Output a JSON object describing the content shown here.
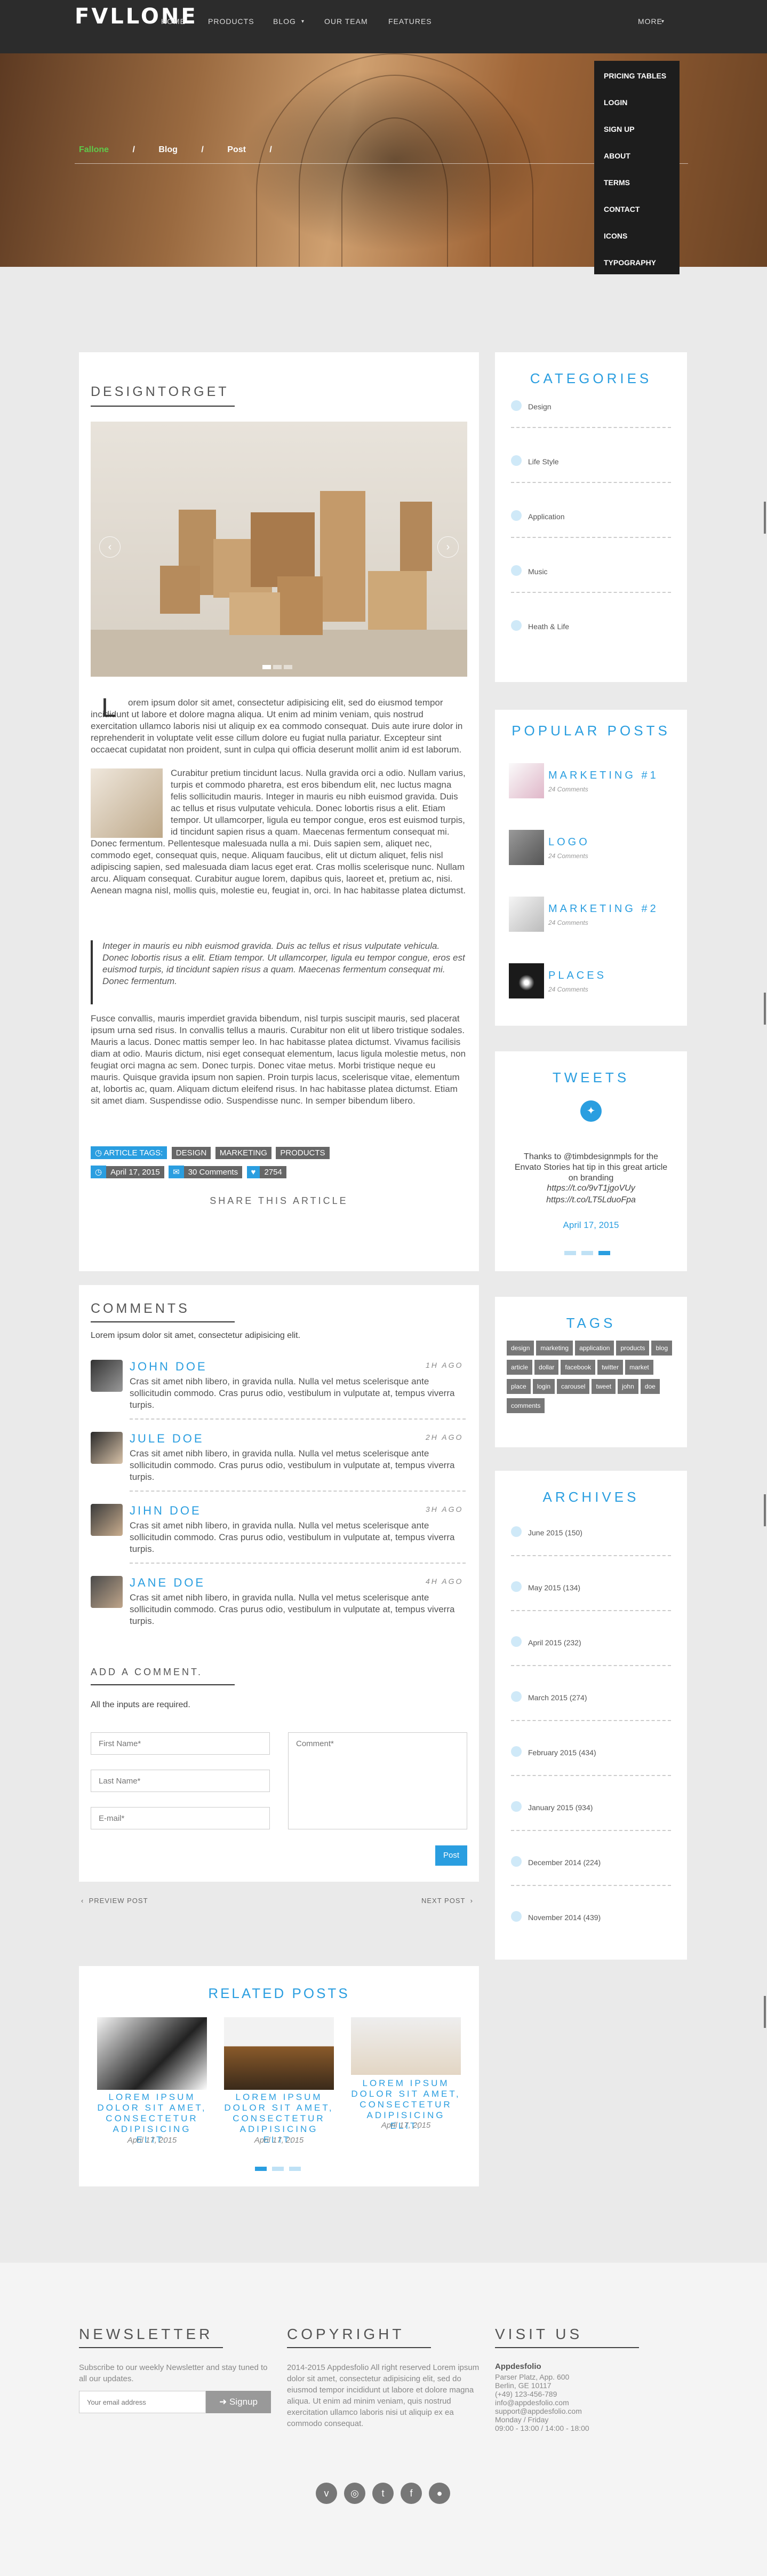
{
  "logo": "FVLLONE",
  "nav": {
    "items": [
      "HOME",
      "PRODUCTS",
      "BLOG",
      "OUR TEAM",
      "FEATURES"
    ],
    "more": "MORE"
  },
  "dropdown": [
    "PRICING TABLES",
    "LOGIN",
    "SIGN UP",
    "ABOUT",
    "TERMS",
    "CONTACT",
    "ICONS",
    "TYPOGRAPHY"
  ],
  "breadcrumb": {
    "home": "Fallone",
    "blog": "Blog",
    "post": "Post",
    "sep": "/"
  },
  "post": {
    "title": "DESIGNTORGET",
    "dropcap": "L",
    "p1": "orem ipsum dolor sit amet, consectetur adipisicing elit, sed do eiusmod tempor incididunt ut labore et dolore magna aliqua. Ut enim ad minim veniam, quis nostrud exercitation ullamco laboris nisi ut aliquip ex ea commodo consequat. Duis aute irure dolor in reprehenderit in voluptate velit esse cillum dolore eu fugiat nulla pariatur. Excepteur sint occaecat cupidatat non proident, sunt in culpa qui officia deserunt mollit anim id est laborum.",
    "p2": "Curabitur pretium tincidunt lacus. Nulla gravida orci a odio. Nullam varius, turpis et commodo pharetra, est eros bibendum elit, nec luctus magna felis sollicitudin mauris. Integer in mauris eu nibh euismod gravida. Duis ac tellus et risus vulputate vehicula. Donec lobortis risus a elit. Etiam tempor. Ut ullamcorper, ligula eu tempor congue, eros est euismod turpis, id tincidunt sapien risus a quam. Maecenas fermentum consequat mi. Donec fermentum. Pellentesque malesuada nulla a mi. Duis sapien sem, aliquet nec, commodo eget, consequat quis, neque. Aliquam faucibus, elit ut dictum aliquet, felis nisl adipiscing sapien, sed malesuada diam lacus eget erat. Cras mollis scelerisque nunc. Nullam arcu. Aliquam consequat. Curabitur augue lorem, dapibus quis, laoreet et, pretium ac, nisi. Aenean magna nisl, mollis quis, molestie eu, feugiat in, orci. In hac habitasse platea dictumst.",
    "quote": "Integer in mauris eu nibh euismod gravida. Duis ac tellus et risus vulputate vehicula. Donec lobortis risus a elit. Etiam tempor. Ut ullamcorper, ligula eu tempor congue, eros est euismod turpis, id tincidunt sapien risus a quam. Maecenas fermentum consequat mi. Donec fermentum.",
    "p3": "Fusce convallis, mauris imperdiet gravida bibendum, nisl turpis suscipit mauris, sed placerat ipsum urna sed risus. In convallis tellus a mauris. Curabitur non elit ut libero tristique sodales. Mauris a lacus. Donec mattis semper leo. In hac habitasse platea dictumst. Vivamus facilisis diam at odio. Mauris dictum, nisi eget consequat elementum, lacus ligula molestie metus, non feugiat orci magna ac sem. Donec turpis. Donec vitae metus. Morbi tristique neque eu mauris. Quisque gravida ipsum non sapien. Proin turpis lacus, scelerisque vitae, elementum at, lobortis ac, quam. Aliquam dictum eleifend risus. In hac habitasse platea dictumst. Etiam sit amet diam. Suspendisse odio. Suspendisse nunc. In semper bibendum libero.",
    "tags_label": "ARTICLE TAGS:",
    "tags": [
      "DESIGN",
      "MARKETING",
      "PRODUCTS"
    ],
    "date": "April 17, 2015",
    "comments": "30 Comments",
    "likes": "2754",
    "share": "SHARE THIS ARTICLE"
  },
  "comments": {
    "title": "COMMENTS",
    "intro": "Lorem ipsum dolor sit amet, consectetur adipisicing elit.",
    "items": [
      {
        "name": "JOHN DOE",
        "time": "1H AGO",
        "text": "Cras sit amet nibh libero, in gravida nulla. Nulla vel metus scelerisque ante sollicitudin commodo. Cras purus odio, vestibulum in vulputate at, tempus viverra turpis."
      },
      {
        "name": "JULE DOE",
        "time": "2H AGO",
        "text": "Cras sit amet nibh libero, in gravida nulla. Nulla vel metus scelerisque ante sollicitudin commodo. Cras purus odio, vestibulum in vulputate at, tempus viverra turpis."
      },
      {
        "name": "JIHN DOE",
        "time": "3H AGO",
        "text": "Cras sit amet nibh libero, in gravida nulla. Nulla vel metus scelerisque ante sollicitudin commodo. Cras purus odio, vestibulum in vulputate at, tempus viverra turpis."
      },
      {
        "name": "JANE DOE",
        "time": "4H AGO",
        "text": "Cras sit amet nibh libero, in gravida nulla. Nulla vel metus scelerisque ante sollicitudin commodo. Cras purus odio, vestibulum in vulputate at, tempus viverra turpis."
      }
    ],
    "add_title": "ADD A COMMENT.",
    "required": "All the inputs are required.",
    "first_name": "First Name*",
    "last_name": "Last Name*",
    "email": "E-mail*",
    "comment": "Comment*",
    "post_button": "Post",
    "prev": "PREVIEW POST",
    "next": "NEXT POST"
  },
  "related": {
    "title": "RELATED POSTS",
    "items": [
      {
        "title": "LOREM IPSUM DOLOR SIT AMET, CONSECTETUR ADIPISICING ELIT.",
        "date": "April 17, 2015"
      },
      {
        "title": "LOREM IPSUM DOLOR SIT AMET, CONSECTETUR ADIPISICING ELIT.",
        "date": "April 17, 2015"
      },
      {
        "title": "LOREM IPSUM DOLOR SIT AMET, CONSECTETUR ADIPISICING ELIT.",
        "date": "April 17, 2015"
      }
    ]
  },
  "sidebar": {
    "categories_title": "CATEGORIES",
    "categories": [
      "Design",
      "Life Style",
      "Application",
      "Music",
      "Heath & Life"
    ],
    "popular_title": "POPULAR POSTS",
    "popular": [
      {
        "title": "MARKETING #1",
        "sub": "24 Comments"
      },
      {
        "title": "LOGO",
        "sub": "24 Comments"
      },
      {
        "title": "MARKETING #2",
        "sub": "24 Comments"
      },
      {
        "title": "PLACES",
        "sub": "24 Comments"
      }
    ],
    "tweets_title": "TWEETS",
    "tweet_text": "Thanks to @timbdesignmpls for the Envato Stories hat tip in this great article on branding",
    "tweet_link1": "https://t.co/9vT1jgoVUy",
    "tweet_link2": "https://t.co/LT5LduoFpa",
    "tweet_date": "April 17, 2015",
    "tags_title": "TAGS",
    "tags": [
      "design",
      "marketing",
      "application",
      "products",
      "blog",
      "article",
      "dollar",
      "facebook",
      "twitter",
      "market",
      "place",
      "login",
      "carousel",
      "tweet",
      "john",
      "doe",
      "comments"
    ],
    "archives_title": "ARCHIVES",
    "archives": [
      "June 2015 (150)",
      "May 2015 (134)",
      "April 2015 (232)",
      "March 2015 (274)",
      "February 2015 (434)",
      "January 2015 (934)",
      "December 2014 (224)",
      "November 2014 (439)"
    ]
  },
  "footer": {
    "newsletter_title": "NEWSLETTER",
    "newsletter_text": "Subscribe to our weekly Newsletter and stay tuned to all our updates.",
    "email_placeholder": "Your email address",
    "signup": "Signup",
    "copyright_title": "COPYRIGHT",
    "copyright_text": "2014-2015 Appdesfolio All right reserved Lorem ipsum dolor sit amet, consectetur adipisicing elit, sed do eiusmod tempor incididunt ut labore et dolore magna aliqua. Ut enim ad minim veniam, quis nostrud exercitation ullamco laboris nisi ut aliquip ex ea commodo consequat.",
    "visit_title": "VISIT US",
    "company": "Appdesfolio",
    "address": [
      "Parser Platz, App. 600",
      "Berlin, GE 10117",
      "(+49) 123-456-789",
      "info@appdesfolio.com",
      "support@appdesfolio.com",
      "Monday / Friday",
      "09:00 - 13:00 / 14:00 - 18:00"
    ]
  },
  "colors": {
    "accent": "#2a9ee0",
    "header_bg": "#2c2c2c",
    "dropdown_bg": "#1d1d1d",
    "breadcrumb_active": "#5fc94a"
  }
}
